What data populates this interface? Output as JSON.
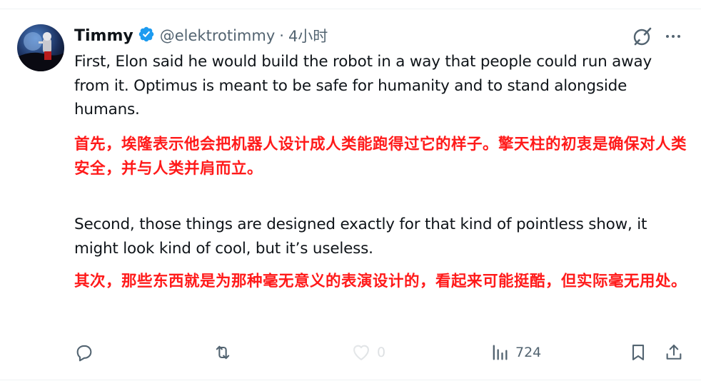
{
  "tweet": {
    "author_name": "Timmy",
    "handle": "@elektrotimmy",
    "separator": "·",
    "time": "4小时",
    "paragraphs": {
      "en1": "First, Elon said he would build the robot in a way that people could run away from it. Optimus is meant to be safe for humanity and to stand alongside humans.",
      "zh1": "首先，埃隆表示他会把机器人设计成人类能跑得过它的样子。擎天柱的初衷是确保对人类安全，并与人类并肩而立。",
      "en2": "Second, those things are designed exactly for that kind of pointless show, it might look kind of cool, but it’s useless.",
      "zh2": "其次，那些东西就是为那种毫无意义的表演设计的，看起来可能挺酷，但实际毫无用处。"
    }
  },
  "actions": {
    "reply_count": "",
    "retweet_count": "",
    "like_count": "0",
    "views_count": "724"
  },
  "icons": [
    "verified-badge-icon",
    "grok-icon",
    "more-icon",
    "reply-icon",
    "retweet-icon",
    "like-icon",
    "views-icon",
    "bookmark-icon",
    "share-icon"
  ],
  "colors": {
    "verified": "#1d9bf0",
    "translation_text": "#ff1a1a",
    "secondary_text": "#536471"
  }
}
